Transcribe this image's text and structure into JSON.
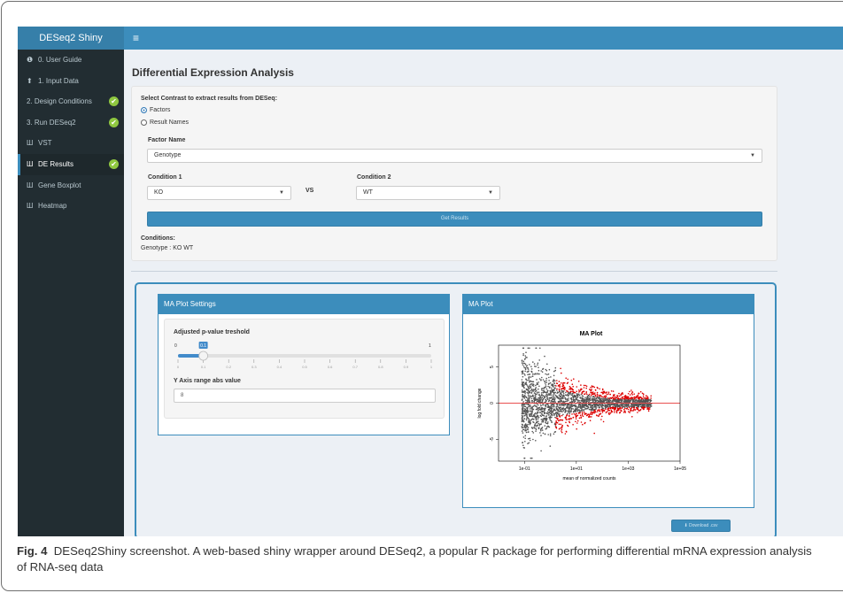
{
  "app": {
    "title": "DESeq2 Shiny",
    "menu_icon": "≡"
  },
  "sidebar": {
    "items": [
      {
        "icon": "info-icon",
        "glyph": "❶",
        "label": "0. User Guide",
        "done": false,
        "active": false
      },
      {
        "icon": "upload-icon",
        "glyph": "⬆",
        "label": "1. Input Data",
        "done": false,
        "active": false
      },
      {
        "icon": "",
        "glyph": "",
        "label": "2. Design Conditions",
        "done": true,
        "active": false
      },
      {
        "icon": "",
        "glyph": "",
        "label": "3. Run DESeq2",
        "done": true,
        "active": false
      },
      {
        "icon": "bar-chart-icon",
        "glyph": "Ш",
        "label": "VST",
        "done": false,
        "active": false
      },
      {
        "icon": "bar-chart-icon",
        "glyph": "Ш",
        "label": "DE Results",
        "done": true,
        "active": true
      },
      {
        "icon": "bar-chart-icon",
        "glyph": "Ш",
        "label": "Gene Boxplot",
        "done": false,
        "active": false
      },
      {
        "icon": "bar-chart-icon",
        "glyph": "Ш",
        "label": "Heatmap",
        "done": false,
        "active": false
      }
    ],
    "check_glyph": "✔"
  },
  "main": {
    "title": "Differential Expression Analysis",
    "contrast_label": "Select Contrast to extract results from DESeq:",
    "radio_options": [
      "Factors",
      "Result Names"
    ],
    "factor_name_label": "Factor Name",
    "factor_name_value": "Genotype",
    "condition1_label": "Condition 1",
    "condition1_value": "KO",
    "vs_label": "VS",
    "condition2_label": "Condition 2",
    "condition2_value": "WT",
    "get_results_label": "Get Results",
    "conditions_label": "Conditions:",
    "conditions_value": "Genotype : KO WT"
  },
  "settings_panel": {
    "title": "MA Plot Settings",
    "pvalue_label": "Adjusted p-value treshold",
    "slider_min": "0",
    "slider_max": "1",
    "slider_value": "0.1",
    "slider_fraction": 0.1,
    "slider_ticks": [
      "0",
      "0.1",
      "0.2",
      "0.3",
      "0.4",
      "0.5",
      "0.6",
      "0.7",
      "0.8",
      "0.9",
      "1"
    ],
    "yaxis_label": "Y Axis range abs value",
    "yaxis_value": "8"
  },
  "plot_panel": {
    "title": "MA Plot",
    "download_label": "Download .csv"
  },
  "chart_data": {
    "type": "scatter",
    "title": "MA Plot",
    "xlabel": "mean of normalized counts",
    "ylabel": "log fold change",
    "x_scale": "log10",
    "xlim": [
      0.01,
      100000
    ],
    "ylim": [
      -8,
      8
    ],
    "x_ticks": [
      "1e-01",
      "1e+01",
      "1e+03",
      "1e+05"
    ],
    "y_ticks": [
      "-5",
      "0",
      "5"
    ],
    "series": [
      {
        "color": "#555555",
        "description": "non-significant genes"
      },
      {
        "color": "#dd0000",
        "description": "significant genes"
      }
    ],
    "reference_line": {
      "y": 0,
      "color": "#e85050"
    }
  },
  "caption": {
    "label": "Fig. 4",
    "text": "DESeq2Shiny screenshot. A web-based shiny wrapper around DESeq2, a popular R package for performing differential mRNA expression analysis of RNA-seq data"
  }
}
